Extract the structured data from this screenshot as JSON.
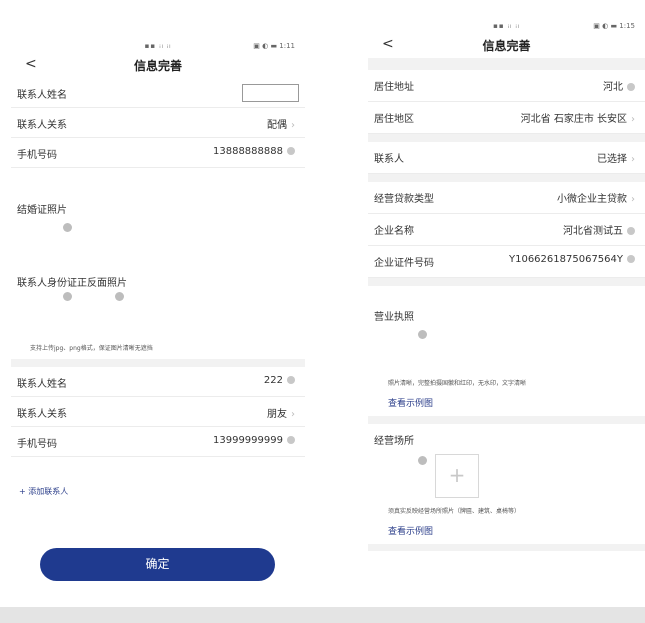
{
  "left": {
    "status": {
      "signal": "▪▪ ᵢₗ ᵢₗ",
      "battery_time": "▣ ◐ ▬ 1:11"
    },
    "nav": {
      "back": "<",
      "title": "信息完善"
    },
    "contact1": {
      "name_label": "联系人姓名",
      "relation_label": "联系人关系",
      "relation_value": "配偶",
      "phone_label": "手机号码",
      "phone_value": "13888888888"
    },
    "marriage_photo_label": "结婚证照片",
    "id_photo_label": "联系人身份证正反面照片",
    "upload_hint": "支持上传jpg、png格式，保证图片清晰无遮挡",
    "contact2": {
      "name_label": "联系人姓名",
      "name_value": "222",
      "relation_label": "联系人关系",
      "relation_value": "朋友",
      "phone_label": "手机号码",
      "phone_value": "13999999999"
    },
    "add_contact": "+ 添加联系人",
    "confirm": "确定"
  },
  "right": {
    "status": {
      "signal": "▪▪ ᵢₗ ᵢₗ",
      "battery_time": "▣ ◐ ▬ 1:15"
    },
    "nav": {
      "back": "<",
      "title": "信息完善"
    },
    "residence_address": {
      "label": "居住地址",
      "value": "河北"
    },
    "residence_area": {
      "label": "居住地区",
      "value": "河北省 石家庄市 长安区"
    },
    "contact": {
      "label": "联系人",
      "value": "已选择"
    },
    "loan_type": {
      "label": "经营贷款类型",
      "value": "小微企业主贷款"
    },
    "company_name": {
      "label": "企业名称",
      "value": "河北省测试五"
    },
    "company_id": {
      "label": "企业证件号码",
      "value": "Y1066261875067564Y"
    },
    "license": {
      "label": "营业执照",
      "hint": "照片清晰，完整拍摄国徽和红印，无水印，文字清晰",
      "example": "查看示例图"
    },
    "premises": {
      "label": "经营场所",
      "hint": "须真实反映经营场所照片（牌匾、建筑、桌椅等）",
      "example": "查看示例图",
      "plus": "+"
    }
  }
}
